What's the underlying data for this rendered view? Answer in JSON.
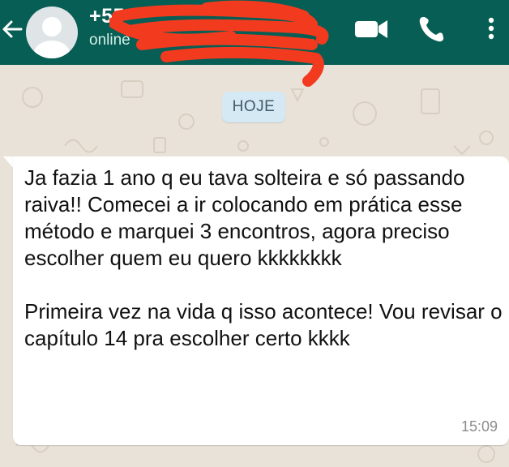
{
  "header": {
    "contact_name": "+55",
    "status": "online",
    "icons": [
      "back-arrow-icon",
      "avatar",
      "video-call-icon",
      "phone-icon",
      "more-options-icon"
    ]
  },
  "chat": {
    "date_label": "HOJE",
    "messages": [
      {
        "text": "Ja fazia 1 ano q eu tava solteira e só passando raiva!!  Comecei a ir colocando em prática esse método e marquei 3 encontros, agora preciso escolher quem eu quero kkkkkkkk\n\nPrimeira vez na vida q isso acontece! Vou revisar o capítulo 14 pra escolher certo kkkk",
        "time": "15:09",
        "direction": "incoming"
      }
    ]
  },
  "colors": {
    "header": "#075e54",
    "wallpaper": "#e9e2d8",
    "bubble": "#ffffff",
    "date_chip": "#d5e9f5",
    "redaction": "#f23a1f"
  }
}
